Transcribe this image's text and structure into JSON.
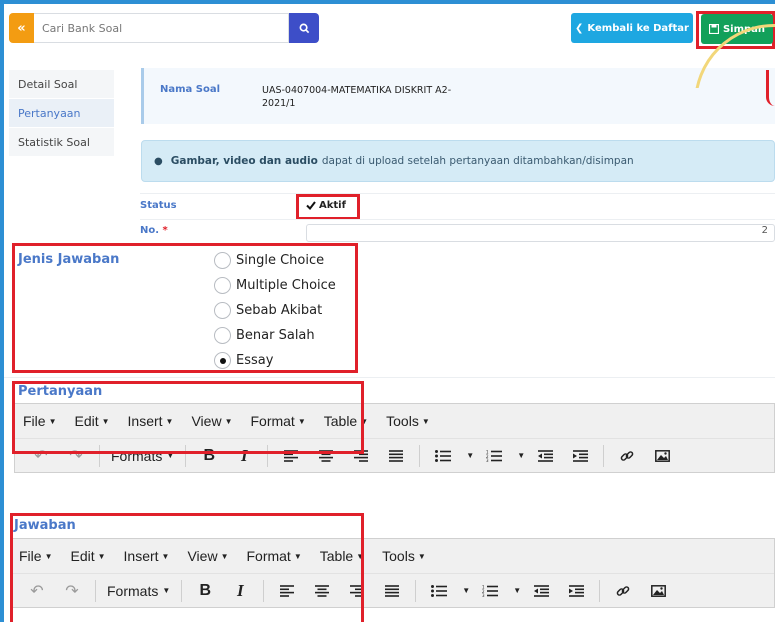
{
  "search": {
    "toggle_label": "«",
    "placeholder": "Cari Bank Soal"
  },
  "header": {
    "back_label": "Kembali ke Daftar",
    "save_label": "Simpan"
  },
  "tabs": [
    {
      "label": "Detail Soal"
    },
    {
      "label": "Pertanyaan"
    },
    {
      "label": "Statistik Soal"
    }
  ],
  "nama_soal": {
    "label": "Nama Soal",
    "value": "UAS-0407004-MATEMATIKA DISKRIT A2-2021/1"
  },
  "alert": {
    "bold": "Gambar, video dan audio",
    "text": "dapat di upload setelah pertanyaan ditambahkan/disimpan"
  },
  "status": {
    "label": "Status",
    "checkbox_label": "Aktif"
  },
  "no": {
    "label": "No.",
    "required_mark": "*",
    "value": "2"
  },
  "jenis_jawaban": {
    "label": "Jenis Jawaban",
    "options": [
      "Single Choice",
      "Multiple Choice",
      "Sebab Akibat",
      "Benar Salah",
      "Essay"
    ],
    "selected": "Essay"
  },
  "pertanyaan": {
    "label": "Pertanyaan"
  },
  "jawaban": {
    "label": "Jawaban"
  },
  "editor": {
    "menus": [
      "File",
      "Edit",
      "Insert",
      "View",
      "Format",
      "Table",
      "Tools"
    ],
    "formats_label": "Formats"
  },
  "colors": {
    "accent": "#4a78c8",
    "save": "#12a05a",
    "back": "#1ea7e1",
    "highlight": "#e0202a"
  }
}
